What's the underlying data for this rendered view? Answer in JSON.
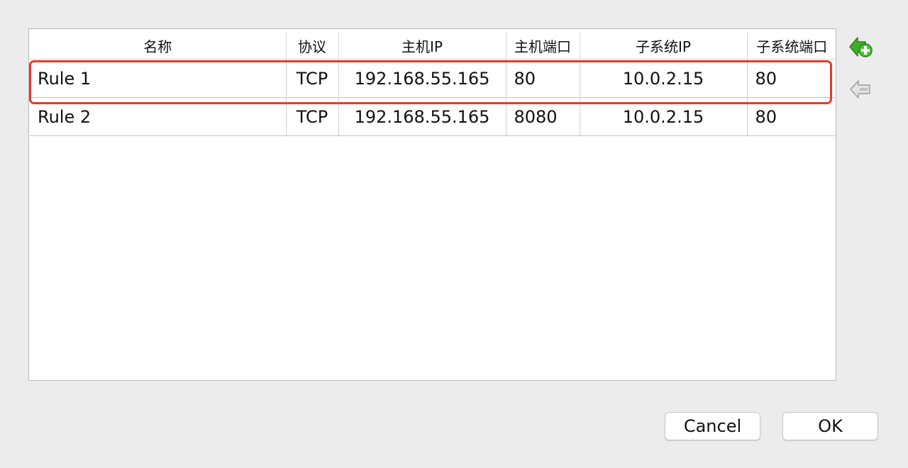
{
  "table": {
    "columns": [
      "名称",
      "协议",
      "主机IP",
      "主机端口",
      "子系统IP",
      "子系统端口"
    ],
    "rows": [
      {
        "name": "Rule 1",
        "protocol": "TCP",
        "host_ip": "192.168.55.165",
        "host_port": "80",
        "guest_ip": "10.0.2.15",
        "guest_port": "80"
      },
      {
        "name": "Rule 2",
        "protocol": "TCP",
        "host_ip": "192.168.55.165",
        "host_port": "8080",
        "guest_ip": "10.0.2.15",
        "guest_port": "80"
      }
    ]
  },
  "side_buttons": {
    "add_icon": "add-rule-icon",
    "remove_icon": "remove-rule-icon"
  },
  "footer": {
    "cancel_label": "Cancel",
    "ok_label": "OK"
  },
  "colors": {
    "highlight": "#e23c2d",
    "add_icon_green": "#3fae2a"
  }
}
